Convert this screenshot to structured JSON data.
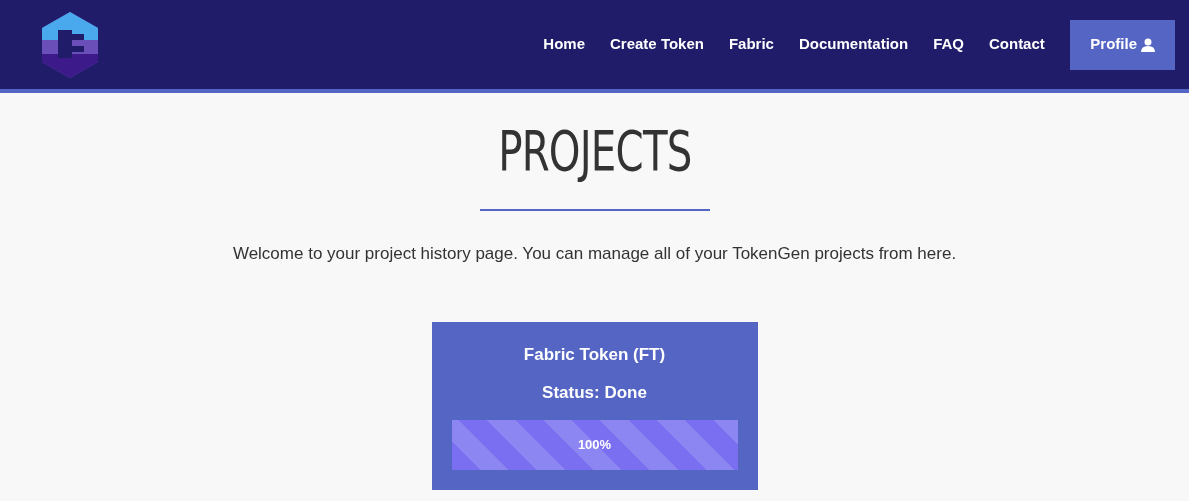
{
  "nav": {
    "links": [
      "Home",
      "Create Token",
      "Fabric",
      "Documentation",
      "FAQ",
      "Contact"
    ],
    "profile": "Profile"
  },
  "page": {
    "title": "PROJECTS",
    "intro": "Welcome to your project history page. You can manage all of your TokenGen projects from here."
  },
  "projects": [
    {
      "name": "Fabric Token (FT)",
      "status": "Status: Done",
      "level": 1,
      "reading": "100%"
    }
  ]
}
